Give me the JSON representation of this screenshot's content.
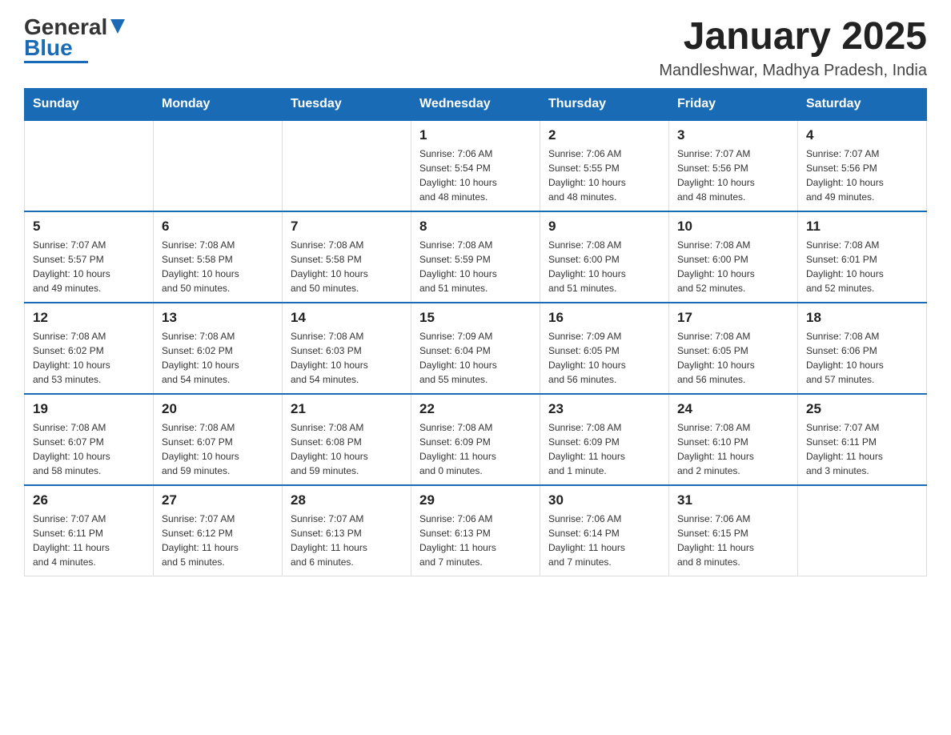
{
  "header": {
    "logo": {
      "text_black": "General",
      "text_blue": "Blue"
    },
    "title": "January 2025",
    "location": "Mandleshwar, Madhya Pradesh, India"
  },
  "weekdays": [
    "Sunday",
    "Monday",
    "Tuesday",
    "Wednesday",
    "Thursday",
    "Friday",
    "Saturday"
  ],
  "weeks": [
    [
      {
        "day": "",
        "info": ""
      },
      {
        "day": "",
        "info": ""
      },
      {
        "day": "",
        "info": ""
      },
      {
        "day": "1",
        "info": "Sunrise: 7:06 AM\nSunset: 5:54 PM\nDaylight: 10 hours\nand 48 minutes."
      },
      {
        "day": "2",
        "info": "Sunrise: 7:06 AM\nSunset: 5:55 PM\nDaylight: 10 hours\nand 48 minutes."
      },
      {
        "day": "3",
        "info": "Sunrise: 7:07 AM\nSunset: 5:56 PM\nDaylight: 10 hours\nand 48 minutes."
      },
      {
        "day": "4",
        "info": "Sunrise: 7:07 AM\nSunset: 5:56 PM\nDaylight: 10 hours\nand 49 minutes."
      }
    ],
    [
      {
        "day": "5",
        "info": "Sunrise: 7:07 AM\nSunset: 5:57 PM\nDaylight: 10 hours\nand 49 minutes."
      },
      {
        "day": "6",
        "info": "Sunrise: 7:08 AM\nSunset: 5:58 PM\nDaylight: 10 hours\nand 50 minutes."
      },
      {
        "day": "7",
        "info": "Sunrise: 7:08 AM\nSunset: 5:58 PM\nDaylight: 10 hours\nand 50 minutes."
      },
      {
        "day": "8",
        "info": "Sunrise: 7:08 AM\nSunset: 5:59 PM\nDaylight: 10 hours\nand 51 minutes."
      },
      {
        "day": "9",
        "info": "Sunrise: 7:08 AM\nSunset: 6:00 PM\nDaylight: 10 hours\nand 51 minutes."
      },
      {
        "day": "10",
        "info": "Sunrise: 7:08 AM\nSunset: 6:00 PM\nDaylight: 10 hours\nand 52 minutes."
      },
      {
        "day": "11",
        "info": "Sunrise: 7:08 AM\nSunset: 6:01 PM\nDaylight: 10 hours\nand 52 minutes."
      }
    ],
    [
      {
        "day": "12",
        "info": "Sunrise: 7:08 AM\nSunset: 6:02 PM\nDaylight: 10 hours\nand 53 minutes."
      },
      {
        "day": "13",
        "info": "Sunrise: 7:08 AM\nSunset: 6:02 PM\nDaylight: 10 hours\nand 54 minutes."
      },
      {
        "day": "14",
        "info": "Sunrise: 7:08 AM\nSunset: 6:03 PM\nDaylight: 10 hours\nand 54 minutes."
      },
      {
        "day": "15",
        "info": "Sunrise: 7:09 AM\nSunset: 6:04 PM\nDaylight: 10 hours\nand 55 minutes."
      },
      {
        "day": "16",
        "info": "Sunrise: 7:09 AM\nSunset: 6:05 PM\nDaylight: 10 hours\nand 56 minutes."
      },
      {
        "day": "17",
        "info": "Sunrise: 7:08 AM\nSunset: 6:05 PM\nDaylight: 10 hours\nand 56 minutes."
      },
      {
        "day": "18",
        "info": "Sunrise: 7:08 AM\nSunset: 6:06 PM\nDaylight: 10 hours\nand 57 minutes."
      }
    ],
    [
      {
        "day": "19",
        "info": "Sunrise: 7:08 AM\nSunset: 6:07 PM\nDaylight: 10 hours\nand 58 minutes."
      },
      {
        "day": "20",
        "info": "Sunrise: 7:08 AM\nSunset: 6:07 PM\nDaylight: 10 hours\nand 59 minutes."
      },
      {
        "day": "21",
        "info": "Sunrise: 7:08 AM\nSunset: 6:08 PM\nDaylight: 10 hours\nand 59 minutes."
      },
      {
        "day": "22",
        "info": "Sunrise: 7:08 AM\nSunset: 6:09 PM\nDaylight: 11 hours\nand 0 minutes."
      },
      {
        "day": "23",
        "info": "Sunrise: 7:08 AM\nSunset: 6:09 PM\nDaylight: 11 hours\nand 1 minute."
      },
      {
        "day": "24",
        "info": "Sunrise: 7:08 AM\nSunset: 6:10 PM\nDaylight: 11 hours\nand 2 minutes."
      },
      {
        "day": "25",
        "info": "Sunrise: 7:07 AM\nSunset: 6:11 PM\nDaylight: 11 hours\nand 3 minutes."
      }
    ],
    [
      {
        "day": "26",
        "info": "Sunrise: 7:07 AM\nSunset: 6:11 PM\nDaylight: 11 hours\nand 4 minutes."
      },
      {
        "day": "27",
        "info": "Sunrise: 7:07 AM\nSunset: 6:12 PM\nDaylight: 11 hours\nand 5 minutes."
      },
      {
        "day": "28",
        "info": "Sunrise: 7:07 AM\nSunset: 6:13 PM\nDaylight: 11 hours\nand 6 minutes."
      },
      {
        "day": "29",
        "info": "Sunrise: 7:06 AM\nSunset: 6:13 PM\nDaylight: 11 hours\nand 7 minutes."
      },
      {
        "day": "30",
        "info": "Sunrise: 7:06 AM\nSunset: 6:14 PM\nDaylight: 11 hours\nand 7 minutes."
      },
      {
        "day": "31",
        "info": "Sunrise: 7:06 AM\nSunset: 6:15 PM\nDaylight: 11 hours\nand 8 minutes."
      },
      {
        "day": "",
        "info": ""
      }
    ]
  ]
}
